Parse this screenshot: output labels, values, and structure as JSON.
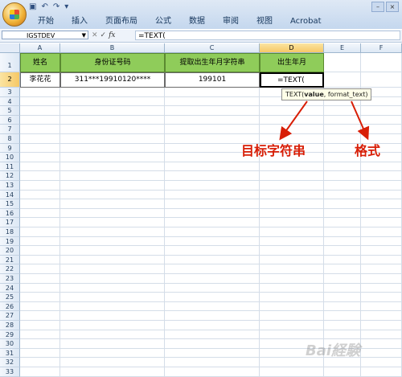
{
  "ribbon": {
    "tabs": [
      "开始",
      "插入",
      "页面布局",
      "公式",
      "数据",
      "审阅",
      "视图",
      "Acrobat"
    ]
  },
  "formula_bar": {
    "name_box": "IGSTDEV",
    "formula": "=TEXT("
  },
  "sheet": {
    "columns": [
      "A",
      "B",
      "C",
      "D",
      "E",
      "F"
    ],
    "header_row": [
      "姓名",
      "身份证号码",
      "提取出生年月字符串",
      "出生年月"
    ],
    "data_row": [
      "李花花",
      "311***19910120****",
      "199101",
      "=TEXT("
    ],
    "row_numbers": [
      "1",
      "2",
      "3",
      "4",
      "5",
      "6",
      "7",
      "8",
      "9",
      "10",
      "11",
      "12",
      "13",
      "14",
      "15",
      "16",
      "17",
      "18",
      "19",
      "20",
      "21",
      "22",
      "23",
      "24",
      "25",
      "26",
      "27",
      "28",
      "29",
      "30",
      "31",
      "32",
      "33"
    ]
  },
  "tooltip": {
    "prefix": "TEXT(",
    "param1": "value",
    "rest": ", format_text)"
  },
  "annotations": {
    "target_string": "目标字符串",
    "format": "格式"
  },
  "colors": {
    "header_fill": "#8fcc5a",
    "annotation": "#d81e06",
    "selected_header": "#f6c866"
  }
}
